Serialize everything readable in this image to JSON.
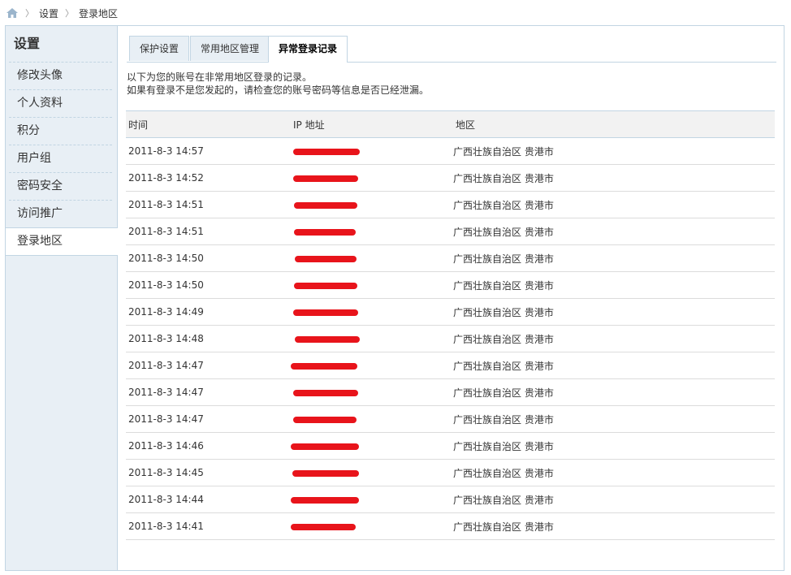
{
  "breadcrumb": {
    "home_icon": "home-icon",
    "items": [
      "设置",
      "登录地区"
    ]
  },
  "sidebar": {
    "title": "设置",
    "items": [
      {
        "label": "修改头像"
      },
      {
        "label": "个人资料"
      },
      {
        "label": "积分"
      },
      {
        "label": "用户组"
      },
      {
        "label": "密码安全"
      },
      {
        "label": "访问推广"
      },
      {
        "label": "登录地区"
      }
    ]
  },
  "tabs": [
    {
      "label": "保护设置"
    },
    {
      "label": "常用地区管理"
    },
    {
      "label": "异常登录记录"
    }
  ],
  "intro": {
    "line1": "以下为您的账号在非常用地区登录的记录。",
    "line2": "如果有登录不是您发起的，请检查您的账号密码等信息是否已经泄漏。"
  },
  "table": {
    "headers": {
      "time": "时间",
      "ip": "IP 地址",
      "region": "地区"
    },
    "rows": [
      {
        "time": "2011-8-3 14:57",
        "region": "广西壮族自治区 贵港市"
      },
      {
        "time": "2011-8-3 14:52",
        "region": "广西壮族自治区 贵港市"
      },
      {
        "time": "2011-8-3 14:51",
        "region": "广西壮族自治区 贵港市"
      },
      {
        "time": "2011-8-3 14:51",
        "region": "广西壮族自治区 贵港市"
      },
      {
        "time": "2011-8-3 14:50",
        "region": "广西壮族自治区 贵港市"
      },
      {
        "time": "2011-8-3 14:50",
        "region": "广西壮族自治区 贵港市"
      },
      {
        "time": "2011-8-3 14:49",
        "region": "广西壮族自治区 贵港市"
      },
      {
        "time": "2011-8-3 14:48",
        "region": "广西壮族自治区 贵港市"
      },
      {
        "time": "2011-8-3 14:47",
        "region": "广西壮族自治区 贵港市"
      },
      {
        "time": "2011-8-3 14:47",
        "region": "广西壮族自治区 贵港市"
      },
      {
        "time": "2011-8-3 14:47",
        "region": "广西壮族自治区 贵港市"
      },
      {
        "time": "2011-8-3 14:46",
        "region": "广西壮族自治区 贵港市"
      },
      {
        "time": "2011-8-3 14:45",
        "region": "广西壮族自治区 贵港市"
      },
      {
        "time": "2011-8-3 14:44",
        "region": "广西壮族自治区 贵港市"
      },
      {
        "time": "2011-8-3 14:41",
        "region": "广西壮族自治区 贵港市"
      }
    ]
  },
  "colors": {
    "border": "#c2d5e3",
    "sidebar_bg": "#e8eff5",
    "redaction": "#e8141b"
  }
}
